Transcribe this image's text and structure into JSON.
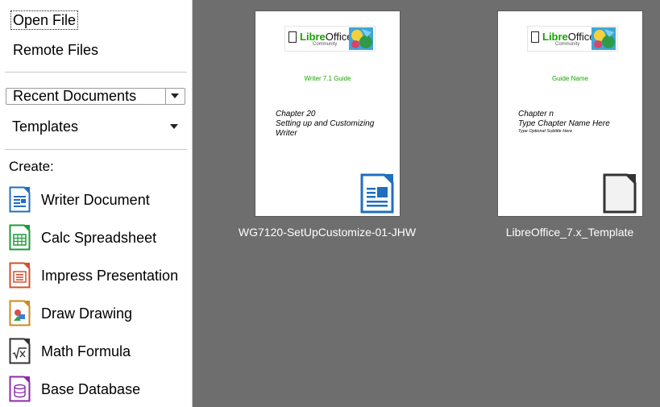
{
  "sidebar": {
    "open_file": "Open File",
    "remote_files": "Remote Files",
    "recent_documents": "Recent Documents",
    "templates": "Templates",
    "create_label": "Create:",
    "create_items": [
      {
        "label": "Writer Document",
        "icon": "writer-document-icon",
        "color": "#1f6fbf"
      },
      {
        "label": "Calc Spreadsheet",
        "icon": "calc-spreadsheet-icon",
        "color": "#1e9b3a"
      },
      {
        "label": "Impress Presentation",
        "icon": "impress-presentation-icon",
        "color": "#d2502c"
      },
      {
        "label": "Draw Drawing",
        "icon": "draw-drawing-icon",
        "color": "#cc8a1c"
      },
      {
        "label": "Math Formula",
        "icon": "math-formula-icon",
        "color": "#333333"
      },
      {
        "label": "Base Database",
        "icon": "base-database-icon",
        "color": "#8e2aa8"
      }
    ]
  },
  "recent": [
    {
      "logo_libre": "Libre",
      "logo_office": "Office",
      "logo_sub": "Community",
      "guide": "Writer 7.1 Guide",
      "chapter_line1": "Chapter 20",
      "chapter_line2": "Setting up and Customizing",
      "chapter_line3": "Writer",
      "subtitle": "",
      "caption": "WG7120-SetUpCustomize-01-JHW",
      "icon": "writer-document-icon"
    },
    {
      "logo_libre": "Libre",
      "logo_office": "Office",
      "logo_sub": "Community",
      "guide": "Guide Name",
      "chapter_line1": "Chapter n",
      "chapter_line2": "Type Chapter Name Here",
      "chapter_line3": "",
      "subtitle": "Type Optional Subtitle Here",
      "caption": "LibreOffice_7.x_Template",
      "icon": "generic-document-icon"
    }
  ],
  "colors": {
    "main_background": "#6e6e6e",
    "accent_green": "#18a303"
  }
}
